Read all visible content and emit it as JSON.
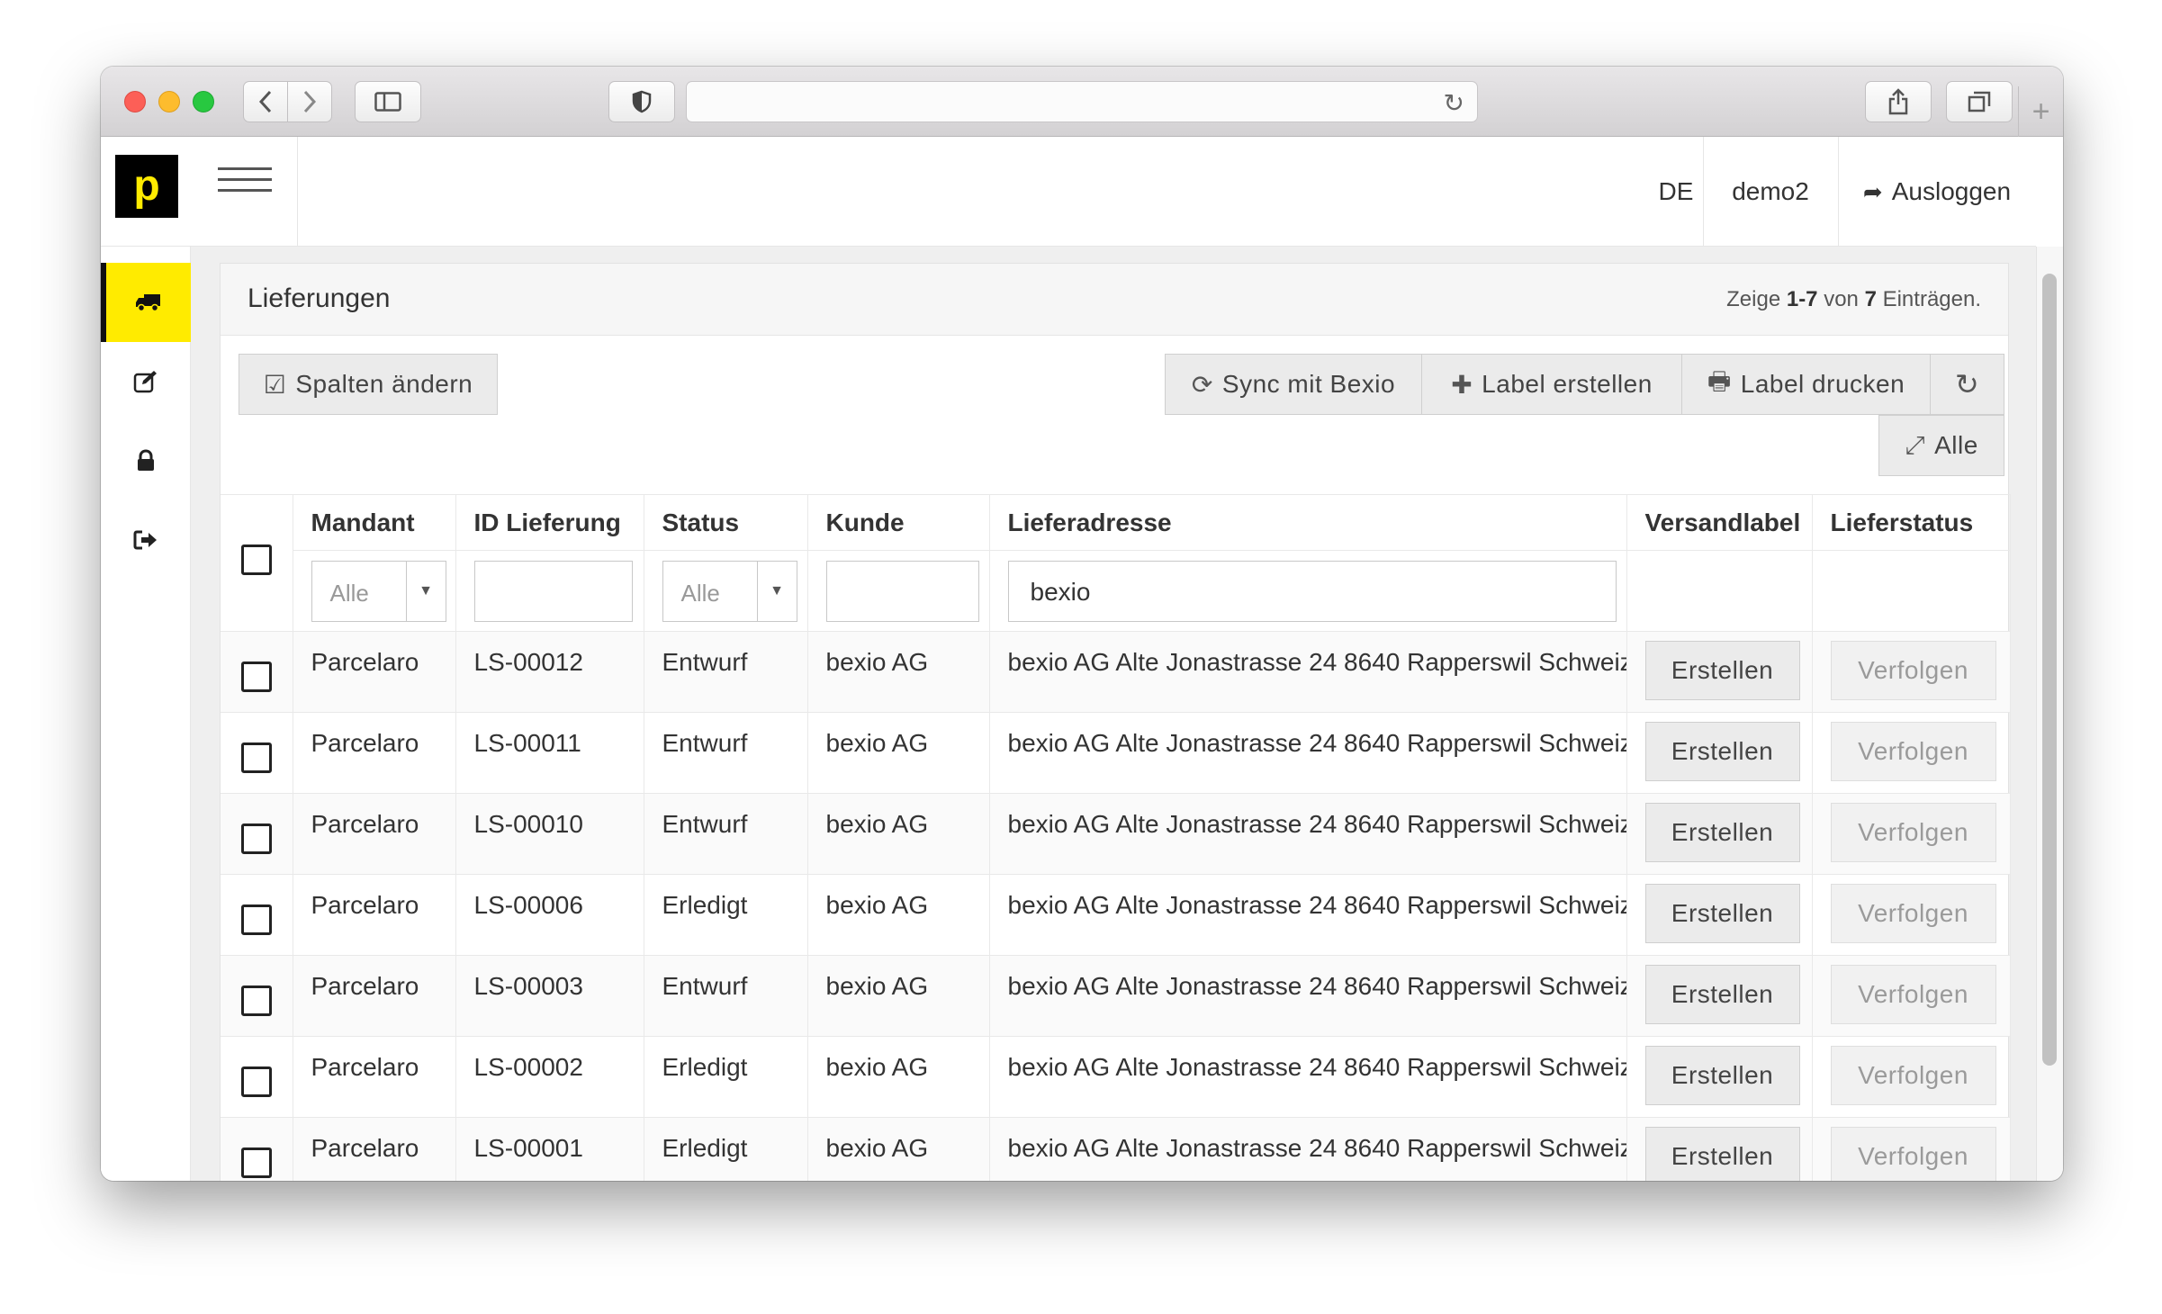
{
  "browser": {
    "icons": {
      "back": "chevron-left-icon",
      "forward": "chevron-right-icon",
      "sidebar": "sidebar-icon",
      "shield": "shield-icon",
      "reload": "reload-icon",
      "share": "share-icon",
      "tabs": "tabs-icon",
      "new_tab": "plus-icon"
    }
  },
  "header": {
    "logo": "p",
    "language": "DE",
    "user": "demo2",
    "logout": "Ausloggen"
  },
  "sidebar": {
    "items": [
      {
        "icon": "truck-icon",
        "active": true
      },
      {
        "icon": "edit-icon",
        "active": false
      },
      {
        "icon": "lock-icon",
        "active": false
      },
      {
        "icon": "logout-icon",
        "active": false
      }
    ]
  },
  "panel": {
    "title": "Lieferungen",
    "count_prefix": "Zeige ",
    "count_range": "1-7",
    "count_mid": " von ",
    "count_total": "7",
    "count_suffix": " Einträgen."
  },
  "toolbar": {
    "columns_label": "Spalten ändern",
    "sync_label": "Sync mit Bexio",
    "create_label": "Label erstellen",
    "print_label": "Label drucken",
    "all_label": "Alle"
  },
  "table": {
    "headers": [
      "Mandant",
      "ID Lieferung",
      "Status",
      "Kunde",
      "Lieferadresse",
      "Versandlabel",
      "Lieferstatus"
    ],
    "filters": {
      "mandant": "Alle",
      "id": "",
      "status": "Alle",
      "kunde": "",
      "lieferadresse": "bexio"
    },
    "create_btn": "Erstellen",
    "track_btn": "Verfolgen",
    "rows": [
      {
        "mandant": "Parcelaro",
        "id": "LS-00012",
        "status": "Entwurf",
        "kunde": "bexio AG",
        "adresse": "bexio AG Alte Jonastrasse 24 8640 Rapperswil Schweiz"
      },
      {
        "mandant": "Parcelaro",
        "id": "LS-00011",
        "status": "Entwurf",
        "kunde": "bexio AG",
        "adresse": "bexio AG Alte Jonastrasse 24 8640 Rapperswil Schweiz"
      },
      {
        "mandant": "Parcelaro",
        "id": "LS-00010",
        "status": "Entwurf",
        "kunde": "bexio AG",
        "adresse": "bexio AG Alte Jonastrasse 24 8640 Rapperswil Schweiz"
      },
      {
        "mandant": "Parcelaro",
        "id": "LS-00006",
        "status": "Erledigt",
        "kunde": "bexio AG",
        "adresse": "bexio AG Alte Jonastrasse 24 8640 Rapperswil Schweiz"
      },
      {
        "mandant": "Parcelaro",
        "id": "LS-00003",
        "status": "Entwurf",
        "kunde": "bexio AG",
        "adresse": "bexio AG Alte Jonastrasse 24 8640 Rapperswil Schweiz"
      },
      {
        "mandant": "Parcelaro",
        "id": "LS-00002",
        "status": "Erledigt",
        "kunde": "bexio AG",
        "adresse": "bexio AG Alte Jonastrasse 24 8640 Rapperswil Schweiz"
      },
      {
        "mandant": "Parcelaro",
        "id": "LS-00001",
        "status": "Erledigt",
        "kunde": "bexio AG",
        "adresse": "bexio AG Alte Jonastrasse 24 8640 Rapperswil Schweiz"
      }
    ]
  },
  "colors": {
    "accent": "#ffeb00",
    "logo_bg": "#000000"
  }
}
